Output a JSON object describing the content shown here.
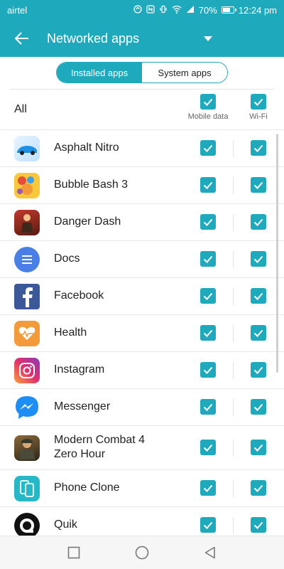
{
  "status_bar": {
    "carrier": "airtel",
    "battery": "70%",
    "time": "12:24 pm",
    "icons": [
      "sync-icon",
      "nfc-icon",
      "vibrate-icon",
      "wifi-icon",
      "signal-icon",
      "battery-icon"
    ]
  },
  "app_bar": {
    "title": "Networked apps",
    "back_icon": "back-arrow-icon",
    "dropdown_icon": "dropdown-triangle-icon"
  },
  "tabs": [
    {
      "label": "Installed apps",
      "selected": true
    },
    {
      "label": "System apps",
      "selected": false
    }
  ],
  "all_row": {
    "label": "All",
    "mobile_data_label": "Mobile data",
    "wifi_label": "Wi-Fi",
    "mobile_checked": true,
    "wifi_checked": true
  },
  "apps": [
    {
      "name": "Asphalt Nitro",
      "mobile": true,
      "wifi": true
    },
    {
      "name": "Bubble Bash 3",
      "mobile": true,
      "wifi": true
    },
    {
      "name": "Danger Dash",
      "mobile": true,
      "wifi": true
    },
    {
      "name": "Docs",
      "mobile": true,
      "wifi": true
    },
    {
      "name": "Facebook",
      "mobile": true,
      "wifi": true
    },
    {
      "name": "Health",
      "mobile": true,
      "wifi": true
    },
    {
      "name": "Instagram",
      "mobile": true,
      "wifi": true
    },
    {
      "name": "Messenger",
      "mobile": true,
      "wifi": true
    },
    {
      "name_line1": "Modern Combat 4",
      "name_line2": "Zero Hour",
      "mobile": true,
      "wifi": true
    },
    {
      "name": "Phone Clone",
      "mobile": true,
      "wifi": true
    },
    {
      "name": "Quik",
      "mobile": true,
      "wifi": true
    }
  ],
  "colors": {
    "accent": "#1fa9bd",
    "divider": "#e8e8e8",
    "nav_bg": "#f6f6f6"
  },
  "nav_bar": [
    "recents-square-icon",
    "home-circle-icon",
    "back-triangle-icon"
  ]
}
